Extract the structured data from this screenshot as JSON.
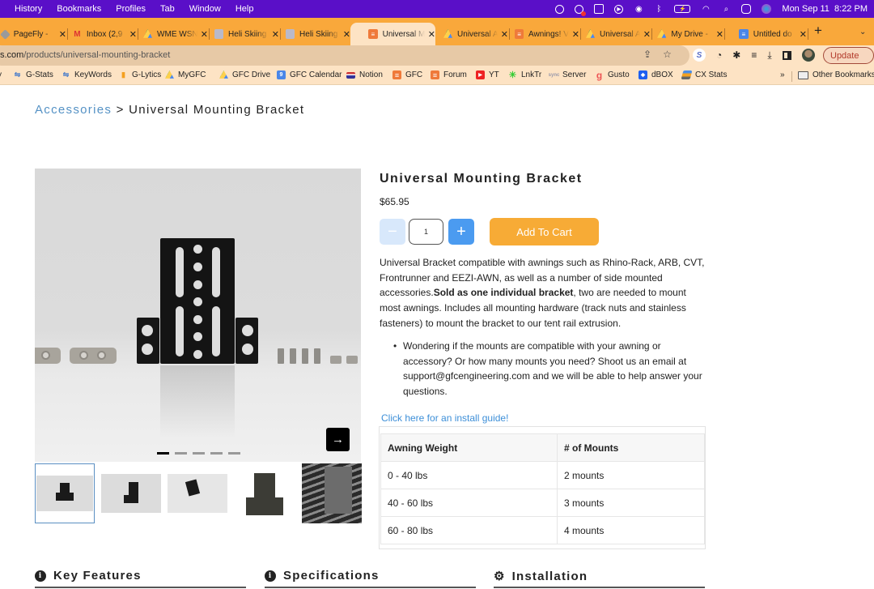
{
  "menubar": {
    "items": [
      "History",
      "Bookmarks",
      "Profiles",
      "Tab",
      "Window",
      "Help"
    ],
    "clock": "Mon Sep 11  8:22 PM",
    "status_icons": [
      "1password-icon",
      "screen-record-icon",
      "layout-icon",
      "play-icon",
      "airdrop-icon",
      "bluetooth-icon",
      "battery-icon",
      "wifi-icon",
      "spotlight-search-icon",
      "control-center-icon",
      "siri-icon"
    ]
  },
  "tabs": [
    {
      "label": "PageFly - ",
      "icon": "pagefly-icon",
      "active": false
    },
    {
      "label": "Inbox (2,9",
      "icon": "gmail-icon",
      "active": false
    },
    {
      "label": "WME WSN",
      "icon": "google-drive-icon",
      "active": false
    },
    {
      "label": "Heli Skiing",
      "icon": "heli-icon",
      "active": false
    },
    {
      "label": "Heli Skiing",
      "icon": "heli-icon",
      "active": false
    },
    {
      "label": "Universal M",
      "icon": "shopify-site-icon",
      "active": true
    },
    {
      "label": "Universal A",
      "icon": "google-drive-icon",
      "active": false
    },
    {
      "label": "Awnings! V",
      "icon": "shopify-site-icon",
      "active": false
    },
    {
      "label": "Universal A",
      "icon": "google-drive-icon",
      "active": false
    },
    {
      "label": "My Drive - ",
      "icon": "google-drive-icon",
      "active": false
    },
    {
      "label": "Untitled do",
      "icon": "google-docs-icon",
      "active": false
    }
  ],
  "toolbar": {
    "url_host": "s.com",
    "url_path": "/products/universal-mounting-bracket",
    "update_label": "Update"
  },
  "bookmarks": {
    "items": [
      {
        "label": "G-Stats",
        "icon": "g-stats-icon"
      },
      {
        "label": "KeyWords",
        "icon": "keywords-icon"
      },
      {
        "label": "G-Lytics",
        "icon": "analytics-icon"
      },
      {
        "label": "MyGFC",
        "icon": "google-drive-icon"
      },
      {
        "label": "GFC Drive",
        "icon": "google-drive-icon"
      },
      {
        "label": "GFC Calendar",
        "icon": "calendar-icon"
      },
      {
        "label": "Notion",
        "icon": "flag-icon"
      },
      {
        "label": "GFC",
        "icon": "shopify-site-icon"
      },
      {
        "label": "Forum",
        "icon": "shopify-site-icon"
      },
      {
        "label": "YT",
        "icon": "youtube-icon"
      },
      {
        "label": "LnkTr",
        "icon": "linktree-icon"
      },
      {
        "label": "Server",
        "icon": "sync-icon"
      },
      {
        "label": "Gusto",
        "icon": "gusto-icon"
      },
      {
        "label": "dBOX",
        "icon": "dropbox-icon"
      },
      {
        "label": "CX Stats",
        "icon": "cx-stats-icon"
      }
    ],
    "more": "»",
    "other_label": "Other Bookmarks"
  },
  "breadcrumb": {
    "parent": "Accessories",
    "separator": ">",
    "current": "Universal Mounting Bracket"
  },
  "gallery": {
    "slide_count": 5,
    "active_slide": 1,
    "next_arrow": "→",
    "thumbnails": [
      {
        "name": "thumb-bracket-front",
        "selected": true
      },
      {
        "name": "thumb-bracket-angle",
        "selected": false
      },
      {
        "name": "thumb-bracket-top",
        "selected": false
      },
      {
        "name": "thumb-bracket-drawing",
        "selected": false
      },
      {
        "name": "thumb-bracket-installed",
        "selected": false
      }
    ]
  },
  "product": {
    "title": "Universal Mounting Bracket",
    "price": "$65.95",
    "quantity": "1",
    "minus_label": "−",
    "plus_label": "+",
    "add_to_cart": "Add To Cart",
    "description_pre": "Universal Bracket compatible with awnings such as Rhino-Rack, ARB, CVT, Frontrunner and EEZI-AWN, as well as a number of side mounted accessories.",
    "description_bold": "Sold as one individual bracket",
    "description_post": ", two are needed to mount most awnings. Includes all mounting hardware (track nuts and stainless fasteners) to mount the bracket to our tent rail extrusion.",
    "bullet": "Wondering if the mounts are compatible with your awning or accessory? Or how many mounts you need? Shoot us an email at support@gfcengineering.com and we will be able to help answer your questions.",
    "install_link": "Click here for an install guide!"
  },
  "mount_table": {
    "headers": [
      "Awning Weight",
      "# of Mounts"
    ],
    "rows": [
      [
        "0 - 40 lbs",
        "2 mounts"
      ],
      [
        "40 - 60 lbs",
        "3 mounts"
      ],
      [
        "60 - 80 lbs",
        "4 mounts"
      ]
    ]
  },
  "sections": [
    {
      "label": "Key Features",
      "icon": "info-icon"
    },
    {
      "label": "Specifications",
      "icon": "info-icon"
    },
    {
      "label": "Installation",
      "icon": "gear-icon"
    }
  ],
  "colors": {
    "menubar": "#5a0fc8",
    "tabstrip": "#f9a83b",
    "toolbar": "#fde3c4",
    "link": "#5592c5",
    "add_to_cart": "#f7ab36",
    "plus_button": "#4b9bf0",
    "minus_button": "#d8e8fb"
  }
}
